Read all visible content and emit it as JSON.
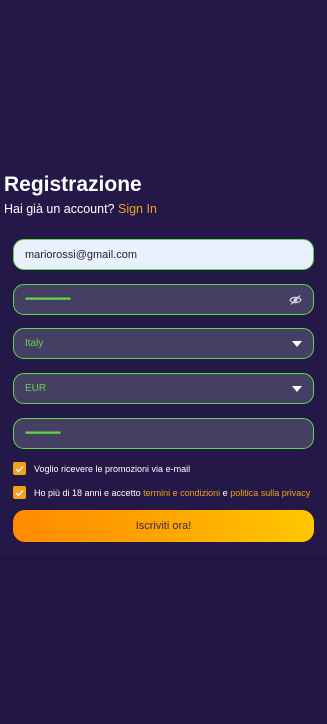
{
  "header": {
    "title": "Registrazione",
    "subtitle": "Hai già un account?",
    "sign_in_link": "Sign In"
  },
  "form": {
    "email_value": "mariorossi@gmail.com",
    "password_mask": "••••••••••••••••••",
    "password_toggle_icon": "eye-slash-icon",
    "country_value": "Italy",
    "currency_value": "EUR",
    "code_mask": "••••••••••••••"
  },
  "checkboxes": {
    "promo_label": "Voglio ricevere le promozioni via e-mail",
    "age_label_prefix": "Ho più di 18 anni e accetto",
    "terms_link": "termini e condizioni",
    "and_text": "e",
    "privacy_link": "politica sulla privacy"
  },
  "submit_label": "Iscriviti ora!",
  "colors": {
    "background": "#211641",
    "panel": "#241848",
    "accent_orange": "#f0a020",
    "field_border_green": "#62d64a",
    "field_fill": "#463f64"
  }
}
